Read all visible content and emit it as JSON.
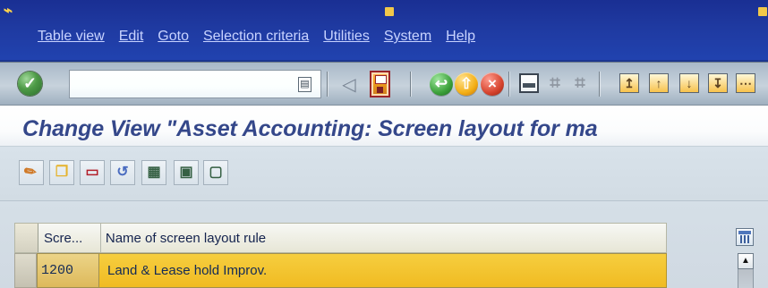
{
  "menubar": {
    "items": [
      {
        "label": "Table view"
      },
      {
        "label": "Edit"
      },
      {
        "label": "Goto"
      },
      {
        "label": "Selection criteria"
      },
      {
        "label": "Utilities"
      },
      {
        "label": "System"
      },
      {
        "label": "Help"
      }
    ]
  },
  "toolbar": {
    "command_field_value": "",
    "icons": [
      "enter-check-icon",
      "command-field-icon",
      "nav-left-icon",
      "save-icon",
      "back-icon",
      "exit-icon",
      "cancel-icon",
      "print-icon",
      "find-icon",
      "find-next-icon",
      "first-page-icon",
      "previous-page-icon",
      "next-page-icon",
      "last-page-icon"
    ]
  },
  "page": {
    "title": "Change View \"Asset Accounting: Screen layout for ma"
  },
  "application_toolbar": {
    "icons": [
      "edit-pencil-icon",
      "copy-icon",
      "delete-icon",
      "undo-icon",
      "select-all-icon",
      "select-block-icon",
      "deselect-icon"
    ]
  },
  "table": {
    "columns": [
      {
        "label": "Scre..."
      },
      {
        "label": "Name of screen layout rule"
      }
    ],
    "rows": [
      {
        "code": "1200",
        "name": "Land & Lease hold Improv."
      }
    ]
  }
}
